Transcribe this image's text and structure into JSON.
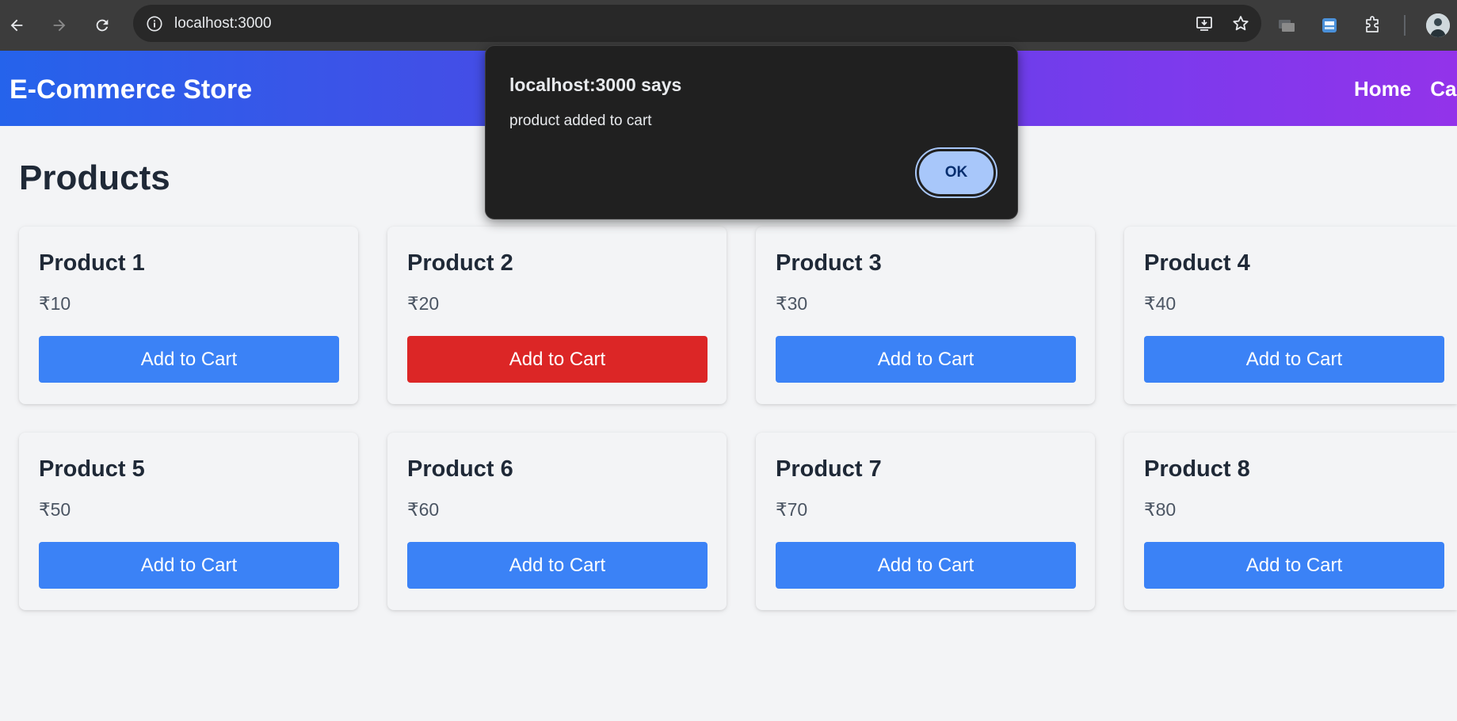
{
  "browser": {
    "url": "localhost:3000"
  },
  "header": {
    "title": "E-Commerce Store",
    "nav": [
      "Home",
      "Ca"
    ]
  },
  "main": {
    "heading": "Products",
    "products": [
      {
        "name": "Product 1",
        "price": "₹10",
        "button": "Add to Cart"
      },
      {
        "name": "Product 2",
        "price": "₹20",
        "button": "Add to Cart"
      },
      {
        "name": "Product 3",
        "price": "₹30",
        "button": "Add to Cart"
      },
      {
        "name": "Product 4",
        "price": "₹40",
        "button": "Add to Cart"
      },
      {
        "name": "Product 5",
        "price": "₹50",
        "button": "Add to Cart"
      },
      {
        "name": "Product 6",
        "price": "₹60",
        "button": "Add to Cart"
      },
      {
        "name": "Product 7",
        "price": "₹70",
        "button": "Add to Cart"
      },
      {
        "name": "Product 8",
        "price": "₹80",
        "button": "Add to Cart"
      }
    ]
  },
  "dialog": {
    "title": "localhost:3000 says",
    "message": "product added to cart",
    "ok_label": "OK"
  },
  "colors": {
    "button_blue": "#3b82f6",
    "button_red_active": "#dc2626",
    "header_gradient_start": "#2563eb",
    "header_gradient_end": "#9333ea"
  }
}
